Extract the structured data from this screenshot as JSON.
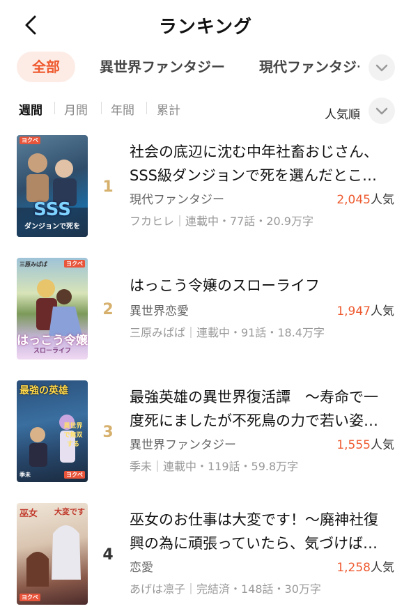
{
  "header": {
    "title": "ランキング"
  },
  "categories": [
    "全部",
    "異世界ファンタジー",
    "現代ファンタジー"
  ],
  "periods": [
    "週間",
    "月間",
    "年間",
    "累計"
  ],
  "sort": {
    "label": "人気順"
  },
  "popularity_suffix": "人気",
  "items": [
    {
      "rank": "1",
      "title": "社会の底辺に沈む中年社畜おじさん、SSS級ダンジョンで死を選んだとこ…",
      "genre": "現代ファンタジー",
      "popularity": "2,045",
      "meta": "フカヒレ｜連載中・77話・20.9万字",
      "cover": {
        "badge": "ヨクペ",
        "text": "SSS",
        "subtext": "ダンジョンで死を"
      }
    },
    {
      "rank": "2",
      "title": "はっこう令嬢のスローライフ",
      "genre": "異世界恋愛",
      "popularity": "1,947",
      "meta": "三原みぱぱ｜連載中・91話・18.4万字",
      "cover": {
        "badge": "ヨクペ",
        "author": "三原みぱぱ",
        "text": "はっこう令嬢",
        "subtext": "スローライフ"
      }
    },
    {
      "rank": "3",
      "title": "最強英雄の異世界復活譚　～寿命で一度死にましたが不死鳥の力で若い姿…",
      "genre": "異世界ファンタジー",
      "popularity": "1,555",
      "meta": "季未｜連載中・119話・59.8万字",
      "cover": {
        "badge": "ヨクペ",
        "text": "最強の英雄",
        "subtext": "異世界で無双する",
        "author": "季未"
      }
    },
    {
      "rank": "4",
      "title": "巫女のお仕事は大変です！～廃神社復興の為に頑張っていたら、気づけば…",
      "genre": "恋愛",
      "popularity": "1,258",
      "meta": "あげは凛子｜完結済・148話・30万字",
      "cover": {
        "badge": "ヨクペ",
        "text": "巫女",
        "subtext": "大変です"
      }
    }
  ],
  "colors": {
    "accent": "#ee5a2f",
    "accent_bg": "#fdece6",
    "rank_gold": "#d6b06c"
  },
  "icons": {
    "back": "chevron-left-icon",
    "expand": "chevron-down-icon"
  }
}
